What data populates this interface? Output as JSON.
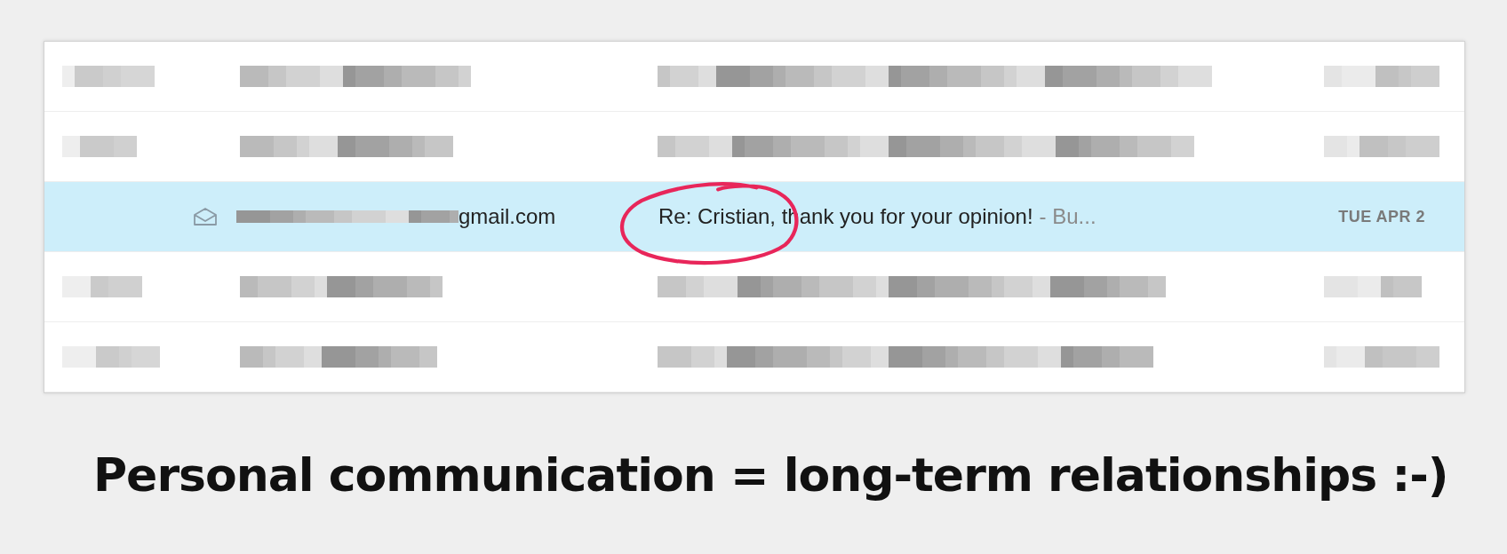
{
  "messages": [
    {
      "kind": "blurred",
      "selected": false
    },
    {
      "kind": "blurred",
      "selected": false
    },
    {
      "kind": "message",
      "selected": true,
      "sender": "gmail.com",
      "subject": "Re: Cristian, thank you for your opinion!",
      "preview": "- Bu...",
      "date": "TUE APR 2"
    },
    {
      "kind": "blurred",
      "selected": false
    },
    {
      "kind": "blurred",
      "selected": false
    }
  ],
  "caption": "Personal communication = long-term relationships :-)"
}
